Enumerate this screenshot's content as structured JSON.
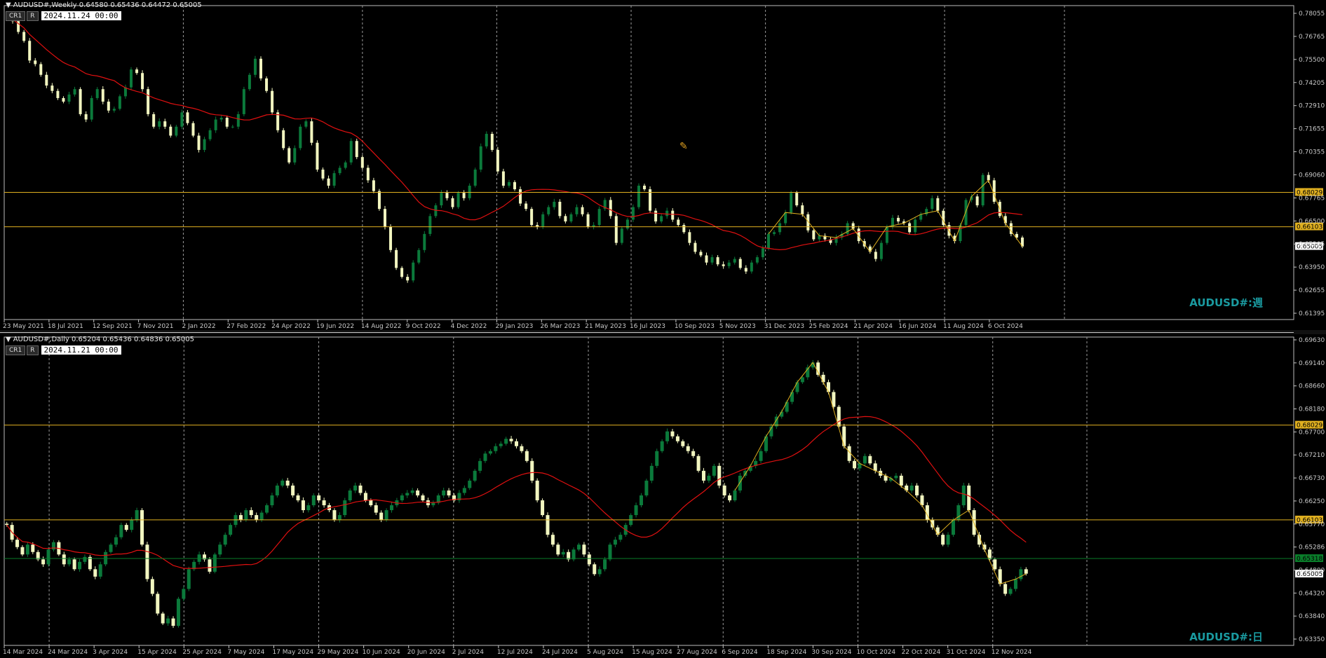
{
  "colors": {
    "background": "#000000",
    "bull": "#0b7a3b",
    "bear": "#f2f6c0",
    "ma": "#e01010",
    "zigzag": "#e0b020",
    "hline": "#e0b020",
    "hline_green": "#0a7d2a",
    "grid": "#9a9a9a",
    "axis_text": "#c8c8c8",
    "symbol_text": "#1a9aa0"
  },
  "chart_data": [
    {
      "type": "candlestick",
      "title": "AUDUSD#,Weekly",
      "ohlc_label": "0.64580 0.65436 0.64472 0.65005",
      "chips": [
        "CR1",
        "R"
      ],
      "datetime": "2024.11.24 00:00",
      "symbol_label": "AUDUSD#:週",
      "ylim": [
        0.6107,
        0.78315
      ],
      "y_ticks": [
        "0.78055",
        "0.76765",
        "0.75500",
        "0.74205",
        "0.72910",
        "0.71655",
        "0.70355",
        "0.69060",
        "0.67765",
        "0.66500",
        "0.65205",
        "0.63950",
        "0.62655",
        "0.61395"
      ],
      "x_ticks": [
        "23 May 2021",
        "18 Jul 2021",
        "12 Sep 2021",
        "7 Nov 2021",
        "2 Jan 2022",
        "27 Feb 2022",
        "24 Apr 2022",
        "19 Jun 2022",
        "14 Aug 2022",
        "9 Oct 2022",
        "4 Dec 2022",
        "29 Jan 2023",
        "26 Mar 2023",
        "21 May 2023",
        "16 Jul 2023",
        "10 Sep 2023",
        "5 Nov 2023",
        "31 Dec 2023",
        "25 Feb 2024",
        "21 Apr 2024",
        "16 Jun 2024",
        "11 Aug 2024",
        "6 Oct 2024"
      ],
      "vlines": [
        "2 Jan 2022",
        "14 Aug 2022",
        "29 Jan 2023",
        "16 Jul 2023",
        "31 Dec 2023",
        "11 Aug 2024"
      ],
      "hlines": [
        {
          "value": 0.68029,
          "label": "0.68029",
          "style": "yellow"
        },
        {
          "value": 0.66103,
          "label": "0.66103",
          "style": "yellow"
        }
      ],
      "current_price": {
        "value": 0.65005,
        "label": "0.65005"
      },
      "series": [
        {
          "name": "close",
          "values": [
            0.778,
            0.776,
            0.77,
            0.765,
            0.754,
            0.752,
            0.746,
            0.74,
            0.737,
            0.733,
            0.731,
            0.735,
            0.738,
            0.724,
            0.721,
            0.733,
            0.738,
            0.731,
            0.726,
            0.727,
            0.734,
            0.739,
            0.749,
            0.747,
            0.738,
            0.724,
            0.717,
            0.72,
            0.717,
            0.712,
            0.717,
            0.725,
            0.719,
            0.712,
            0.704,
            0.71,
            0.715,
            0.721,
            0.722,
            0.717,
            0.717,
            0.724,
            0.738,
            0.746,
            0.755,
            0.744,
            0.737,
            0.725,
            0.715,
            0.705,
            0.697,
            0.705,
            0.717,
            0.72,
            0.708,
            0.693,
            0.688,
            0.684,
            0.691,
            0.694,
            0.697,
            0.709,
            0.7,
            0.694,
            0.687,
            0.681,
            0.671,
            0.661,
            0.648,
            0.638,
            0.633,
            0.631,
            0.641,
            0.648,
            0.657,
            0.667,
            0.673,
            0.68,
            0.677,
            0.672,
            0.68,
            0.677,
            0.684,
            0.693,
            0.706,
            0.713,
            0.704,
            0.692,
            0.684,
            0.686,
            0.682,
            0.674,
            0.671,
            0.662,
            0.661,
            0.668,
            0.672,
            0.675,
            0.667,
            0.664,
            0.668,
            0.672,
            0.668,
            0.661,
            0.662,
            0.671,
            0.676,
            0.667,
            0.652,
            0.66,
            0.665,
            0.672,
            0.684,
            0.682,
            0.67,
            0.664,
            0.667,
            0.67,
            0.665,
            0.662,
            0.658,
            0.652,
            0.647,
            0.645,
            0.641,
            0.644,
            0.64,
            0.639,
            0.641,
            0.643,
            0.638,
            0.636,
            0.641,
            0.644,
            0.649,
            0.657,
            0.658,
            0.663,
            0.669,
            0.68,
            0.673,
            0.668,
            0.659,
            0.654,
            0.656,
            0.654,
            0.652,
            0.655,
            0.657,
            0.663,
            0.66,
            0.653,
            0.65,
            0.647,
            0.643,
            0.652,
            0.661,
            0.666,
            0.664,
            0.663,
            0.658,
            0.665,
            0.668,
            0.671,
            0.677,
            0.67,
            0.662,
            0.656,
            0.653,
            0.662,
            0.676,
            0.678,
            0.673,
            0.69,
            0.687,
            0.675,
            0.667,
            0.663,
            0.657,
            0.655,
            0.65
          ]
        }
      ]
    },
    {
      "type": "candlestick",
      "title": "AUDUSD#,Daily",
      "ohlc_label": "0.65204 0.65436 0.64836 0.65005",
      "chips": [
        "CR1",
        "R"
      ],
      "datetime": "2024.11.21 00:00",
      "symbol_label": "AUDUSD#:日",
      "ylim": [
        0.6361,
        0.6976
      ],
      "y_ticks": [
        "0.69630",
        "0.69140",
        "0.68660",
        "0.68180",
        "0.67700",
        "0.67210",
        "0.66730",
        "0.66250",
        "0.65770",
        "0.65286",
        "0.64800",
        "0.64320",
        "0.63840",
        "0.63350"
      ],
      "x_ticks": [
        "14 Mar 2024",
        "24 Mar 2024",
        "3 Apr 2024",
        "15 Apr 2024",
        "25 Apr 2024",
        "7 May 2024",
        "17 May 2024",
        "29 May 2024",
        "10 Jun 2024",
        "20 Jun 2024",
        "2 Jul 2024",
        "12 Jul 2024",
        "24 Jul 2024",
        "5 Aug 2024",
        "15 Aug 2024",
        "27 Aug 2024",
        "6 Sep 2024",
        "18 Sep 2024",
        "30 Sep 2024",
        "10 Oct 2024",
        "22 Oct 2024",
        "31 Oct 2024",
        "12 Nov 2024"
      ],
      "vlines": [
        "24 Mar 2024",
        "25 Apr 2024",
        "29 May 2024",
        "2 Jul 2024",
        "5 Aug 2024",
        "6 Sep 2024",
        "10 Oct 2024",
        "12 Nov 2024"
      ],
      "hlines": [
        {
          "value": 0.68029,
          "label": "0.68029",
          "style": "yellow"
        },
        {
          "value": 0.66103,
          "label": "0.66103",
          "style": "yellow"
        },
        {
          "value": 0.65318,
          "label": "0.65318",
          "style": "green"
        }
      ],
      "current_price": {
        "value": 0.65005,
        "label": "0.65005"
      },
      "series": [
        {
          "name": "close",
          "values": [
            0.66,
            0.657,
            0.6555,
            0.654,
            0.656,
            0.6545,
            0.653,
            0.652,
            0.655,
            0.6565,
            0.654,
            0.652,
            0.653,
            0.651,
            0.6525,
            0.6535,
            0.651,
            0.6495,
            0.652,
            0.6545,
            0.656,
            0.6575,
            0.66,
            0.659,
            0.661,
            0.663,
            0.656,
            0.649,
            0.646,
            0.642,
            0.64,
            0.641,
            0.6395,
            0.645,
            0.647,
            0.651,
            0.6525,
            0.654,
            0.653,
            0.6505,
            0.654,
            0.656,
            0.658,
            0.66,
            0.662,
            0.661,
            0.663,
            0.662,
            0.661,
            0.6625,
            0.664,
            0.666,
            0.668,
            0.669,
            0.668,
            0.666,
            0.665,
            0.663,
            0.664,
            0.666,
            0.665,
            0.664,
            0.663,
            0.661,
            0.662,
            0.665,
            0.667,
            0.668,
            0.6665,
            0.665,
            0.664,
            0.6625,
            0.661,
            0.663,
            0.664,
            0.665,
            0.666,
            0.6665,
            0.667,
            0.666,
            0.665,
            0.664,
            0.6645,
            0.666,
            0.667,
            0.666,
            0.665,
            0.6665,
            0.6675,
            0.669,
            0.671,
            0.673,
            0.6745,
            0.675,
            0.676,
            0.6765,
            0.6775,
            0.677,
            0.676,
            0.675,
            0.673,
            0.669,
            0.665,
            0.662,
            0.658,
            0.656,
            0.654,
            0.6545,
            0.653,
            0.655,
            0.656,
            0.654,
            0.652,
            0.65,
            0.651,
            0.653,
            0.656,
            0.657,
            0.658,
            0.66,
            0.662,
            0.664,
            0.666,
            0.669,
            0.672,
            0.675,
            0.677,
            0.679,
            0.678,
            0.677,
            0.676,
            0.675,
            0.674,
            0.671,
            0.669,
            0.67,
            0.672,
            0.668,
            0.666,
            0.665,
            0.667,
            0.67,
            0.671,
            0.672,
            0.673,
            0.675,
            0.678,
            0.68,
            0.682,
            0.683,
            0.685,
            0.687,
            0.689,
            0.69,
            0.692,
            0.693,
            0.6905,
            0.689,
            0.687,
            0.684,
            0.68,
            0.676,
            0.673,
            0.6715,
            0.6725,
            0.674,
            0.6725,
            0.671,
            0.67,
            0.669,
            0.6695,
            0.67,
            0.668,
            0.667,
            0.668,
            0.666,
            0.664,
            0.661,
            0.6595,
            0.658,
            0.656,
            0.658,
            0.661,
            0.664,
            0.668,
            0.663,
            0.658,
            0.656,
            0.655,
            0.653,
            0.651,
            0.648,
            0.646,
            0.647,
            0.649,
            0.651,
            0.6501
          ]
        }
      ]
    }
  ]
}
